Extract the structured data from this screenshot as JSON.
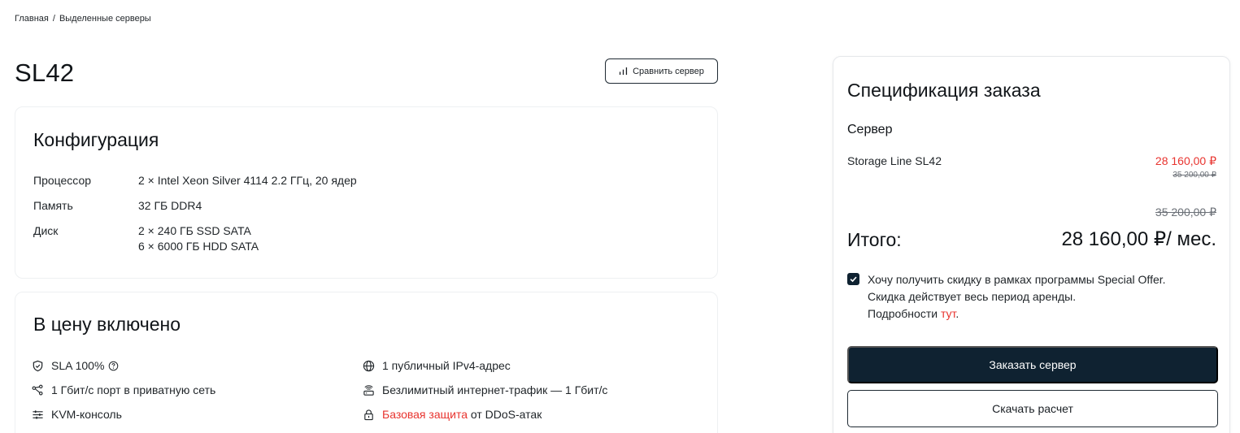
{
  "breadcrumb": {
    "home": "Главная",
    "separator": "/",
    "current": "Выделенные серверы"
  },
  "page": {
    "title": "SL42",
    "compare_label": "Сравнить сервер"
  },
  "config": {
    "title": "Конфигурация",
    "rows": [
      {
        "label": "Процессор",
        "values": [
          "2 × Intel Xeon Silver 4114 2.2 ГГц, 20 ядер"
        ]
      },
      {
        "label": "Память",
        "values": [
          "32 ГБ DDR4"
        ]
      },
      {
        "label": "Диск",
        "values": [
          "2 × 240 ГБ SSD SATA",
          "6 × 6000 ГБ HDD SATA"
        ]
      }
    ]
  },
  "included": {
    "title": "В цену включено",
    "sla": "SLA 100%",
    "private_port": "1 Гбит/с порт в приватную сеть",
    "kvm": "KVM-консоль",
    "ipv4": "1 публичный IPv4-адрес",
    "traffic": "Безлимитный интернет-трафик — 1 Гбит/с",
    "ddos_link": "Базовая защита",
    "ddos_rest": " от DDoS-атак"
  },
  "order": {
    "title": "Спецификация заказа",
    "section": "Сервер",
    "item_name": "Storage Line SL42",
    "item_price_new": "28 160,00 ₽",
    "item_price_old": "35 200,00 ₽",
    "total_old": "35 200,00 ₽",
    "total_label": "Итого:",
    "total_value": "28 160,00 ₽/ мес.",
    "offer_line1": "Хочу получить скидку в рамках программы Special Offer.",
    "offer_line2": "Скидка действует весь период аренды.",
    "offer_line3": "Подробности ",
    "offer_link": "тут",
    "offer_end": ".",
    "offer_checked": true,
    "order_button": "Заказать сервер",
    "download_button": "Скачать расчет"
  },
  "colors": {
    "accent": "#e8342f",
    "dark": "#0f2231"
  }
}
